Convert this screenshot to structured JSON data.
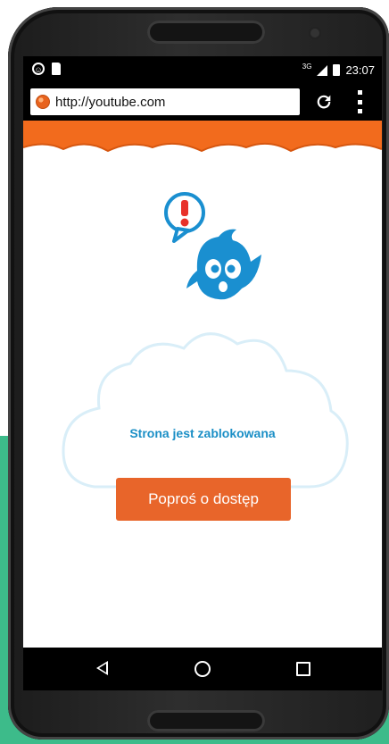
{
  "statusbar": {
    "network": "3G",
    "time": "23:07"
  },
  "browser": {
    "url": "http://youtube.com"
  },
  "page": {
    "blocked_message": "Strona jest zablokowana",
    "request_button_label": "Poproś o dostęp"
  },
  "colors": {
    "accent_orange": "#f26b1d",
    "button_orange": "#e8652a",
    "message_blue": "#1b8fc6",
    "mascot_blue": "#1a8fd0",
    "alert_red": "#e8312a",
    "backdrop_green": "#3dbb8a"
  },
  "icons": {
    "status_left": [
      "accessibility-icon",
      "sd-card-icon"
    ],
    "status_right": [
      "signal-icon",
      "battery-icon"
    ],
    "browser": [
      "globe-icon",
      "refresh-icon",
      "overflow-menu-icon"
    ],
    "navigation": [
      "back-icon",
      "home-icon",
      "recent-apps-icon"
    ]
  }
}
